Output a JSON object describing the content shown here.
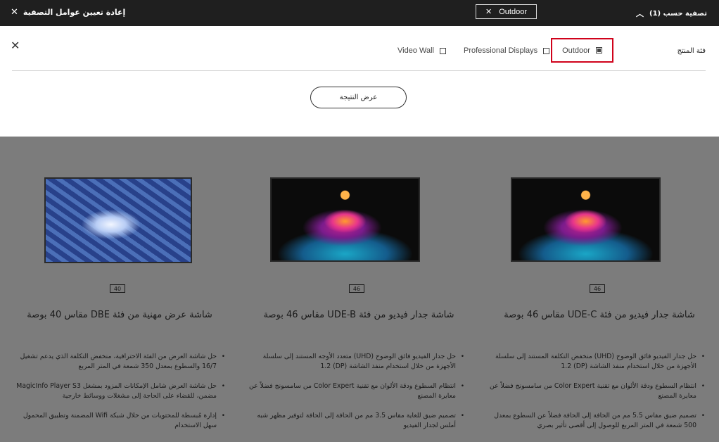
{
  "topbar": {
    "reset_label": "إعادة تعيين عوامل التصفية",
    "active_chip": "Outdoor",
    "filter_by": "تصفية حسب (1)"
  },
  "filter_panel": {
    "category_label": "فئة المنتج",
    "options": [
      {
        "label": "Video Wall",
        "checked": false
      },
      {
        "label": "Professional Displays",
        "checked": false
      },
      {
        "label": "Outdoor",
        "checked": true
      }
    ],
    "apply_button": "عرض النتيجة"
  },
  "products": [
    {
      "size": "46",
      "image": "liquid-splash",
      "title": "شاشة جدار فيديو من فئة UDE-C مقاس 46 بوصة",
      "features": [
        "حل جدار الفيديو فائق الوضوح (UHD) منخفض التكلفة المستند إلى سلسلة الأجهزة من خلال استخدام منفذ الشاشة (DP) 1.2",
        "انتظام السطوع ودقة الألوان مع تقنية Color Expert من سامسونج فضلاً عن معايرة المصنع",
        "تصميم ضيق مقاس 5.5 مم من الحافة إلى الحافة فضلاً عن السطوع بمعدل 500 شمعة في المتر المربع للوصول إلى أقصى تأثير بصري"
      ]
    },
    {
      "size": "46",
      "image": "liquid-splash",
      "title": "شاشة جدار فيديو من فئة UDE-B مقاس 46 بوصة",
      "features": [
        "حل جدار الفيديو فائق الوضوح (UHD) متعدد الأوجه المستند إلى سلسلة الأجهزة من خلال استخدام منفذ الشاشة (DP) 1.2",
        "انتظام السطوع ودقة الألوان مع تقنية Color Expert من سامسونج فضلاً عن معايرة المصنع",
        "تصميم ضيق للغاية مقاس 3.5 مم من الحافة إلى الحافة لتوفير مظهر شبه أملس لجدار الفيديو"
      ]
    },
    {
      "size": "40",
      "image": "blue-tunnel",
      "title": "شاشة عرض مهنية من فئة DBE مقاس 40 بوصة",
      "features": [
        "حل شاشة العرض من الفئة الاحترافية، منخفض التكلفة الذي يدعم تشغيل 16/7 والسطوع بمعدل 350 شمعة في المتر المربع",
        "حل شاشة العرض شامل الإمكانات المزود بمشغل MagicInfo Player S3 مضمن، للقضاء على الحاجة إلى مشغلات ووسائط خارجية",
        "إدارة مُبسطة للمحتويات من خلال شبكة Wifi المضمنة وتطبيق المحمول سهل الاستخدام"
      ]
    }
  ]
}
